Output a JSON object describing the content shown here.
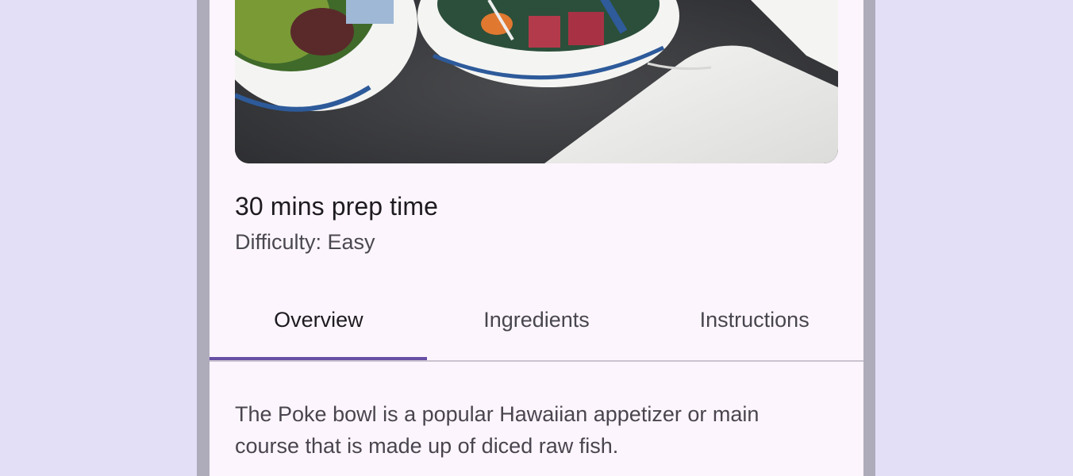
{
  "recipe": {
    "hero_image_alt": "poke-bowl-photo",
    "prep_time": "30 mins prep time",
    "difficulty": "Difficulty: Easy"
  },
  "tabs": [
    {
      "label": "Overview",
      "selected": true
    },
    {
      "label": "Ingredients",
      "selected": false
    },
    {
      "label": "Instructions",
      "selected": false
    }
  ],
  "overview": {
    "text": "The Poke bowl is a popular Hawaiian appetizer or main course that is made up of diced raw fish."
  },
  "colors": {
    "background": "#e3dff6",
    "frame": "#aeabbb",
    "surface": "#fdf5fd",
    "accent": "#6750a4",
    "divider": "#cac4d0"
  }
}
